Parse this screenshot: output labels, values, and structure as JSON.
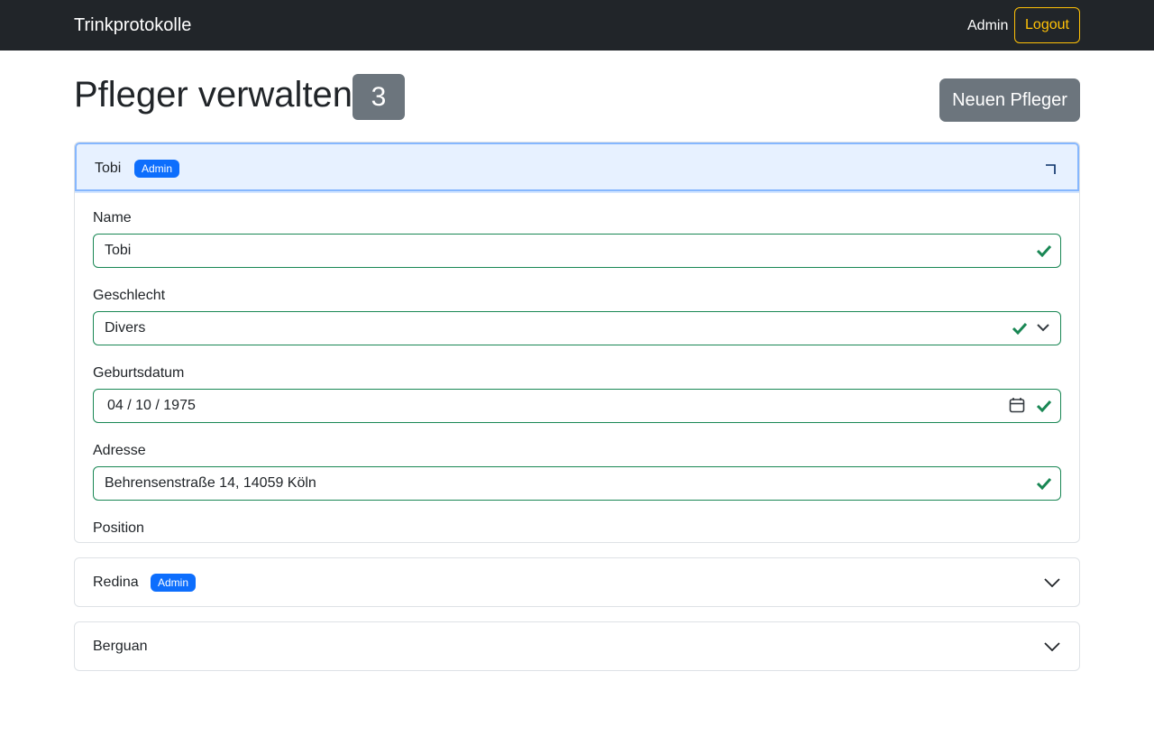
{
  "navbar": {
    "brand": "Trinkprotokolle",
    "admin_link": "Admin",
    "logout_label": "Logout"
  },
  "page": {
    "title": "Pfleger verwalten",
    "count": "3",
    "new_button": "Neuen Pfleger"
  },
  "accordion": [
    {
      "name": "Tobi",
      "badge": "Admin",
      "expanded": true,
      "fields": {
        "name": {
          "label": "Name",
          "value": "Tobi"
        },
        "gender": {
          "label": "Geschlecht",
          "value": "Divers"
        },
        "birthdate": {
          "label": "Geburtsdatum",
          "value": "04 / 10 / 1975"
        },
        "address": {
          "label": "Adresse",
          "value": "Behrensenstraße 14, 14059 Köln"
        },
        "position": {
          "label": "Position"
        }
      }
    },
    {
      "name": "Redina",
      "badge": "Admin",
      "expanded": false
    },
    {
      "name": "Berguan",
      "expanded": false
    }
  ],
  "colors": {
    "navbar_bg": "#212529",
    "logout": "#ffc107",
    "primary": "#0d6efd",
    "secondary": "#6c757d",
    "valid": "#198754",
    "active_header_bg": "#e7f1ff"
  }
}
